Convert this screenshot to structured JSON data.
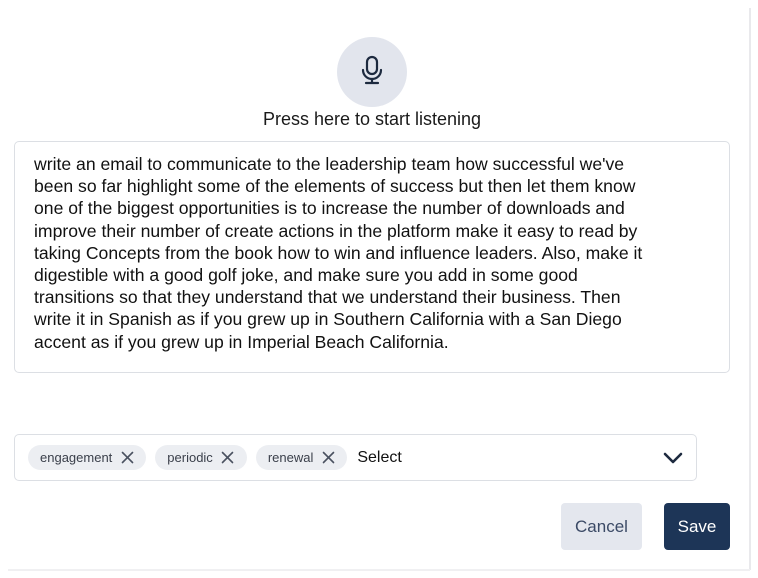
{
  "listener": {
    "icon": "microphone-icon",
    "label": "Press here to start listening"
  },
  "transcript": {
    "value": "write an email to communicate to the leadership team how successful we've\nbeen so far highlight some of the elements of success but then let them know\none of the biggest opportunities is to increase the number of downloads and\nimprove their number of create actions in the platform make it easy to read by\ntaking Concepts from the book how to win and influence leaders. Also, make it\ndigestible with a good golf joke, and make sure you add in some good\ntransitions so that they understand that we understand their business. Then\nwrite it in Spanish as if you grew up in Southern California with a San Diego\naccent as if you grew up in Imperial Beach California."
  },
  "tags": {
    "chips": [
      {
        "label": "engagement"
      },
      {
        "label": "periodic"
      },
      {
        "label": "renewal"
      }
    ],
    "placeholder": "Select",
    "remove_icon": "close-icon",
    "dropdown_icon": "chevron-down-icon"
  },
  "actions": {
    "cancel_label": "Cancel",
    "save_label": "Save"
  },
  "colors": {
    "mic_bg": "#e2e5ed",
    "chip_bg": "#eceef2",
    "cancel_bg": "#e4e7ee",
    "save_bg": "#1d3557"
  }
}
